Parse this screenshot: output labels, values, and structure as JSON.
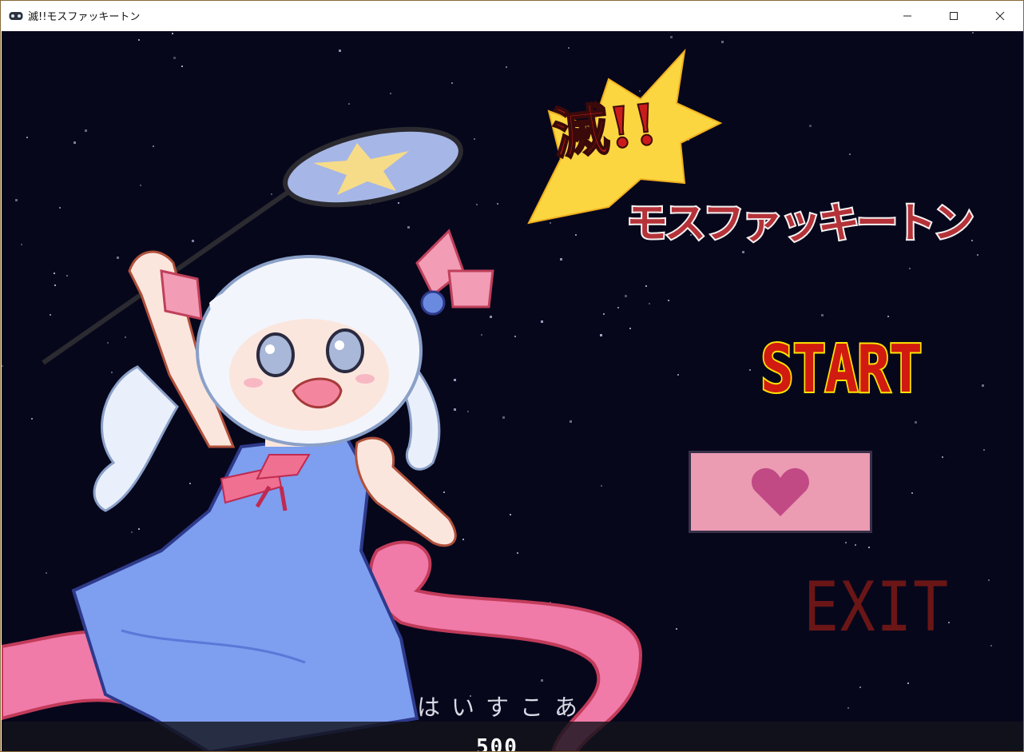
{
  "window": {
    "title": "滅!!モスファッキートン",
    "icon": "gamepad-icon",
    "controls": [
      "minimize-icon",
      "maximize-icon",
      "close-icon"
    ]
  },
  "logo": {
    "kanji": "滅!!",
    "subtitle": "モスファッキートン"
  },
  "menu": {
    "start_label": "START",
    "gallery_icon": "heart-icon",
    "exit_label": "EXIT"
  },
  "credit": "はいすこあ",
  "version": "500",
  "colors": {
    "background": "#07071c",
    "start_fill": "#d11a10",
    "start_outline": "#ffe400",
    "gallery_panel": "#eb9bb2",
    "heart": "#c14a85",
    "exit": "#6b1616"
  }
}
